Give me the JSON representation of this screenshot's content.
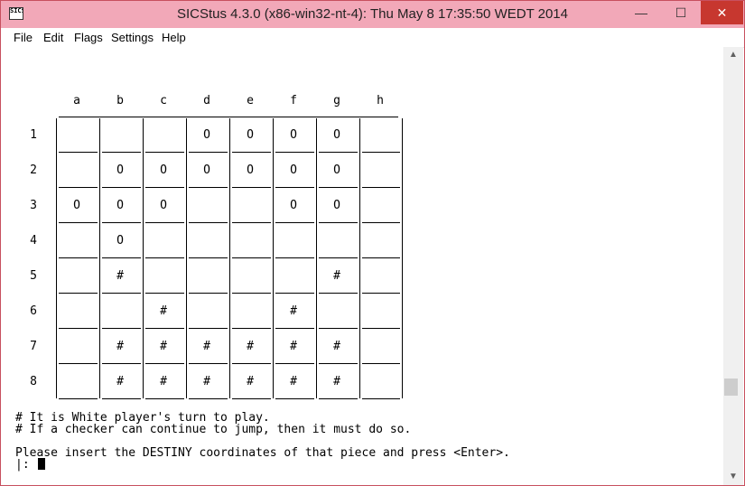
{
  "window": {
    "title": "SICStus 4.3.0 (x86-win32-nt-4): Thu May  8 17:35:50 WEDT 2014",
    "app_icon_text": "SICS"
  },
  "controls": {
    "minimize": "—",
    "maximize": "☐",
    "close": "✕"
  },
  "menu": [
    "File",
    "Edit",
    "Flags",
    "Settings",
    "Help"
  ],
  "board": {
    "columns": [
      "a",
      "b",
      "c",
      "d",
      "e",
      "f",
      "g",
      "h"
    ],
    "rows": [
      {
        "label": "1",
        "cells": [
          "",
          "",
          "",
          "O",
          "O",
          "O",
          "O",
          ""
        ]
      },
      {
        "label": "2",
        "cells": [
          "",
          "O",
          "O",
          "O",
          "O",
          "O",
          "O",
          ""
        ]
      },
      {
        "label": "3",
        "cells": [
          "O",
          "O",
          "O",
          "",
          "",
          "O",
          "O",
          ""
        ]
      },
      {
        "label": "4",
        "cells": [
          "",
          "O",
          "",
          "",
          "",
          "",
          "",
          ""
        ]
      },
      {
        "label": "5",
        "cells": [
          "",
          "#",
          "",
          "",
          "",
          "",
          "#",
          ""
        ]
      },
      {
        "label": "6",
        "cells": [
          "",
          "",
          "#",
          "",
          "",
          "#",
          "",
          ""
        ]
      },
      {
        "label": "7",
        "cells": [
          "",
          "#",
          "#",
          "#",
          "#",
          "#",
          "#",
          ""
        ]
      },
      {
        "label": "8",
        "cells": [
          "",
          "#",
          "#",
          "#",
          "#",
          "#",
          "#",
          ""
        ]
      }
    ]
  },
  "messages": {
    "turn": "# It is White player's turn to play.",
    "jump_rule": "# If a checker can continue to jump, then it must do so.",
    "prompt": "Please insert the DESTINY coordinates of that piece and press <Enter>.",
    "input_prefix": "|: "
  },
  "scrollbar": {
    "up": "▲",
    "down": "▼"
  }
}
